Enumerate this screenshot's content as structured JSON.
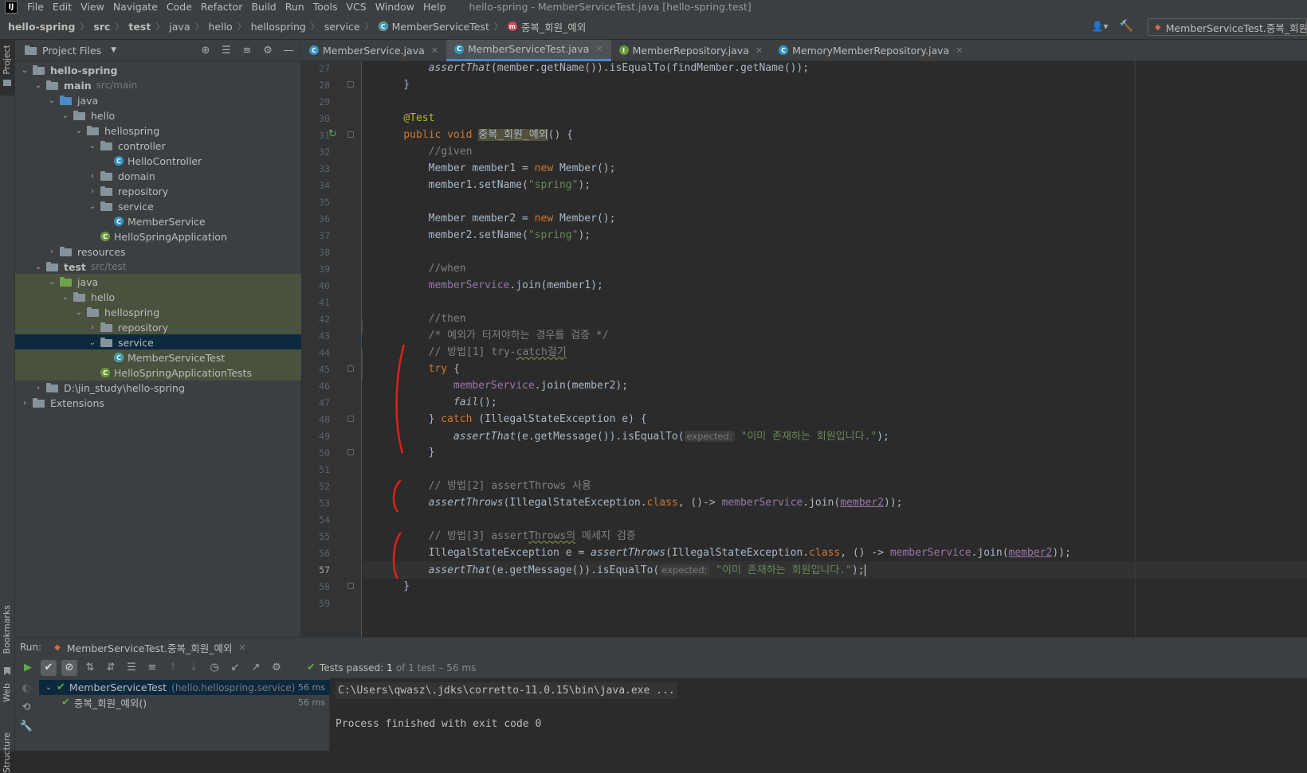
{
  "app": {
    "logo": "IJ",
    "window_title": "hello-spring - MemberServiceTest.java [hello-spring.test]"
  },
  "menu": [
    "File",
    "Edit",
    "View",
    "Navigate",
    "Code",
    "Refactor",
    "Build",
    "Run",
    "Tools",
    "VCS",
    "Window",
    "Help"
  ],
  "breadcrumb": [
    "hello-spring",
    "src",
    "test",
    "java",
    "hello",
    "hellospring",
    "service",
    "MemberServiceTest",
    "중복_회원_예외"
  ],
  "run_config": "MemberServiceTest.중복_회원_예외",
  "project": {
    "title": "Project Files",
    "tree": [
      {
        "label": "hello-spring",
        "depth": 0,
        "open": true,
        "type": "module",
        "bold": true
      },
      {
        "label": "main",
        "sub": "src/main",
        "depth": 1,
        "open": true,
        "type": "module",
        "bold": true
      },
      {
        "label": "java",
        "depth": 2,
        "open": true,
        "type": "src"
      },
      {
        "label": "hello",
        "depth": 3,
        "open": true,
        "type": "pkg"
      },
      {
        "label": "hellospring",
        "depth": 4,
        "open": true,
        "type": "pkg"
      },
      {
        "label": "controller",
        "depth": 5,
        "open": true,
        "type": "pkg"
      },
      {
        "label": "HelloController",
        "depth": 6,
        "type": "class"
      },
      {
        "label": "domain",
        "depth": 5,
        "open": false,
        "type": "pkg"
      },
      {
        "label": "repository",
        "depth": 5,
        "open": false,
        "type": "pkg"
      },
      {
        "label": "service",
        "depth": 5,
        "open": true,
        "type": "pkg"
      },
      {
        "label": "MemberService",
        "depth": 6,
        "type": "class"
      },
      {
        "label": "HelloSpringApplication",
        "depth": 5,
        "type": "springclass"
      },
      {
        "label": "resources",
        "depth": 2,
        "open": false,
        "type": "res"
      },
      {
        "label": "test",
        "sub": "src/test",
        "depth": 1,
        "open": true,
        "type": "module",
        "bold": true
      },
      {
        "label": "java",
        "depth": 2,
        "open": true,
        "type": "tst",
        "green": true
      },
      {
        "label": "hello",
        "depth": 3,
        "open": true,
        "type": "pkg",
        "green": true
      },
      {
        "label": "hellospring",
        "depth": 4,
        "open": true,
        "type": "pkg",
        "green": true
      },
      {
        "label": "repository",
        "depth": 5,
        "open": false,
        "type": "pkg",
        "green": true
      },
      {
        "label": "service",
        "depth": 5,
        "open": true,
        "type": "pkg",
        "selected": true
      },
      {
        "label": "MemberServiceTest",
        "depth": 6,
        "type": "testclass",
        "green": true
      },
      {
        "label": "HelloSpringApplicationTests",
        "depth": 5,
        "type": "springclass",
        "green": true
      },
      {
        "label": "D:\\jin_study\\hello-spring",
        "depth": 1,
        "open": false,
        "type": "module"
      },
      {
        "label": "Extensions",
        "depth": 0,
        "open": false,
        "type": "pkg"
      }
    ]
  },
  "tabs": [
    {
      "label": "MemberService.java",
      "icon": "class",
      "active": false
    },
    {
      "label": "MemberServiceTest.java",
      "icon": "class",
      "active": true
    },
    {
      "label": "MemberRepository.java",
      "icon": "interface",
      "active": false
    },
    {
      "label": "MemoryMemberRepository.java",
      "icon": "class",
      "active": false
    }
  ],
  "editor": {
    "current_line": 57,
    "lines": [
      {
        "n": 27,
        "c": [
          [
            "        ",
            ""
          ],
          [
            "assertThat",
            "it"
          ],
          [
            "(member.getName()).isEqualTo(findMember.getName());",
            ""
          ]
        ]
      },
      {
        "n": 28,
        "c": [
          [
            "    }",
            ""
          ]
        ]
      },
      {
        "n": 29,
        "c": []
      },
      {
        "n": 30,
        "c": [
          [
            "    ",
            ""
          ],
          [
            "@Test",
            "an"
          ]
        ]
      },
      {
        "n": 31,
        "c": [
          [
            "    ",
            ""
          ],
          [
            "public void ",
            "kw"
          ],
          [
            "중복_회원_예외",
            "hl"
          ],
          [
            "() {",
            ""
          ]
        ]
      },
      {
        "n": 32,
        "c": [
          [
            "        ",
            ""
          ],
          [
            "//given",
            "cm"
          ]
        ]
      },
      {
        "n": 33,
        "c": [
          [
            "        Member member1 = ",
            ""
          ],
          [
            "new ",
            "kw"
          ],
          [
            "Member();",
            ""
          ]
        ]
      },
      {
        "n": 34,
        "c": [
          [
            "        member1.setName(",
            ""
          ],
          [
            "\"spring\"",
            "st"
          ],
          [
            ");",
            ""
          ]
        ]
      },
      {
        "n": 35,
        "c": []
      },
      {
        "n": 36,
        "c": [
          [
            "        Member member2 = ",
            ""
          ],
          [
            "new ",
            "kw"
          ],
          [
            "Member();",
            ""
          ]
        ]
      },
      {
        "n": 37,
        "c": [
          [
            "        member2.setName(",
            ""
          ],
          [
            "\"spring\"",
            "st"
          ],
          [
            ");",
            ""
          ]
        ]
      },
      {
        "n": 38,
        "c": []
      },
      {
        "n": 39,
        "c": [
          [
            "        ",
            ""
          ],
          [
            "//when",
            "cm"
          ]
        ]
      },
      {
        "n": 40,
        "c": [
          [
            "        ",
            ""
          ],
          [
            "memberService",
            "fd"
          ],
          [
            ".join(member1);",
            ""
          ]
        ]
      },
      {
        "n": 41,
        "c": []
      },
      {
        "n": 42,
        "c": [
          [
            "        ",
            ""
          ],
          [
            "//then",
            "cm"
          ]
        ]
      },
      {
        "n": 43,
        "c": [
          [
            "        ",
            ""
          ],
          [
            "/* 예외가 터져야하는 경우를 검증 */",
            "cm"
          ]
        ]
      },
      {
        "n": 44,
        "c": [
          [
            "        ",
            ""
          ],
          [
            "// 방법[1] try-",
            "cm"
          ],
          [
            "catch걸기",
            "cm wv"
          ]
        ]
      },
      {
        "n": 45,
        "c": [
          [
            "        ",
            ""
          ],
          [
            "try ",
            "kw"
          ],
          [
            "{",
            ""
          ]
        ]
      },
      {
        "n": 46,
        "c": [
          [
            "            ",
            ""
          ],
          [
            "memberService",
            "fd"
          ],
          [
            ".join(member2);",
            ""
          ]
        ]
      },
      {
        "n": 47,
        "c": [
          [
            "            ",
            ""
          ],
          [
            "fail",
            "it"
          ],
          [
            "();",
            ""
          ]
        ]
      },
      {
        "n": 48,
        "c": [
          [
            "        } ",
            ""
          ],
          [
            "catch ",
            "kw"
          ],
          [
            "(IllegalStateException e) {",
            ""
          ]
        ]
      },
      {
        "n": 49,
        "c": [
          [
            "            ",
            ""
          ],
          [
            "assertThat",
            "it"
          ],
          [
            "(e.getMessage()).isEqualTo(",
            ""
          ],
          [
            "expected:",
            "hint"
          ],
          [
            " ",
            ""
          ],
          [
            "\"이미 존재하는 회원입니다.\"",
            "st"
          ],
          [
            ");",
            ""
          ]
        ]
      },
      {
        "n": 50,
        "c": [
          [
            "        }",
            ""
          ]
        ]
      },
      {
        "n": 51,
        "c": []
      },
      {
        "n": 52,
        "c": [
          [
            "        ",
            ""
          ],
          [
            "// 방법[2] assertThrows 사용",
            "cm"
          ]
        ]
      },
      {
        "n": 53,
        "c": [
          [
            "        ",
            ""
          ],
          [
            "assertThrows",
            "it"
          ],
          [
            "(IllegalStateException.",
            ""
          ],
          [
            "class",
            "kw"
          ],
          [
            ", ()-> ",
            ""
          ],
          [
            "memberService",
            "fd"
          ],
          [
            ".join(",
            ""
          ],
          [
            "member2",
            "fd ul"
          ],
          [
            "));",
            ""
          ]
        ]
      },
      {
        "n": 54,
        "c": []
      },
      {
        "n": 55,
        "c": [
          [
            "        ",
            ""
          ],
          [
            "// 방법[3] assert",
            "cm"
          ],
          [
            "Throws의",
            "cm wv"
          ],
          [
            " 메세지 검증",
            "cm"
          ]
        ]
      },
      {
        "n": 56,
        "c": [
          [
            "        IllegalStateException e = ",
            ""
          ],
          [
            "assertThrows",
            "it"
          ],
          [
            "(IllegalStateException.",
            ""
          ],
          [
            "class",
            "kw"
          ],
          [
            ", () -> ",
            ""
          ],
          [
            "memberService",
            "fd"
          ],
          [
            ".join(",
            ""
          ],
          [
            "member2",
            "fd ul"
          ],
          [
            "));",
            ""
          ]
        ]
      },
      {
        "n": 57,
        "c": [
          [
            "        ",
            ""
          ],
          [
            "assertThat",
            "it"
          ],
          [
            "(e.getMessage()).isEqualTo(",
            ""
          ],
          [
            "expected:",
            "hint"
          ],
          [
            " ",
            ""
          ],
          [
            "\"이미 존재하는 회원입니다.\"",
            "st"
          ],
          [
            ");",
            ""
          ]
        ]
      },
      {
        "n": 58,
        "c": [
          [
            "    }",
            ""
          ]
        ]
      },
      {
        "n": 59,
        "c": []
      }
    ]
  },
  "run": {
    "label": "Run:",
    "tab": "MemberServiceTest.중복_회원_예외",
    "status_prefix": "Tests passed:",
    "status_count": "1",
    "status_rest": "of 1 test – 56 ms",
    "tree": [
      {
        "label": "MemberServiceTest",
        "sub": "(hello.hellospring.service)",
        "time": "56 ms"
      },
      {
        "label": "중복_회원_예외()",
        "time": "56 ms"
      }
    ],
    "console": [
      "C:\\Users\\qwasz\\.jdks\\corretto-11.0.15\\bin\\java.exe ...",
      "",
      "Process finished with exit code 0"
    ]
  },
  "sidebar_labels": {
    "project": "Project",
    "bookmarks": "Bookmarks",
    "web": "Web",
    "structure": "Structure"
  },
  "colors": {
    "accent": "#4a88c7",
    "selection": "#0d293e",
    "test_bg": "#49523f",
    "pass": "#5fa84a"
  }
}
